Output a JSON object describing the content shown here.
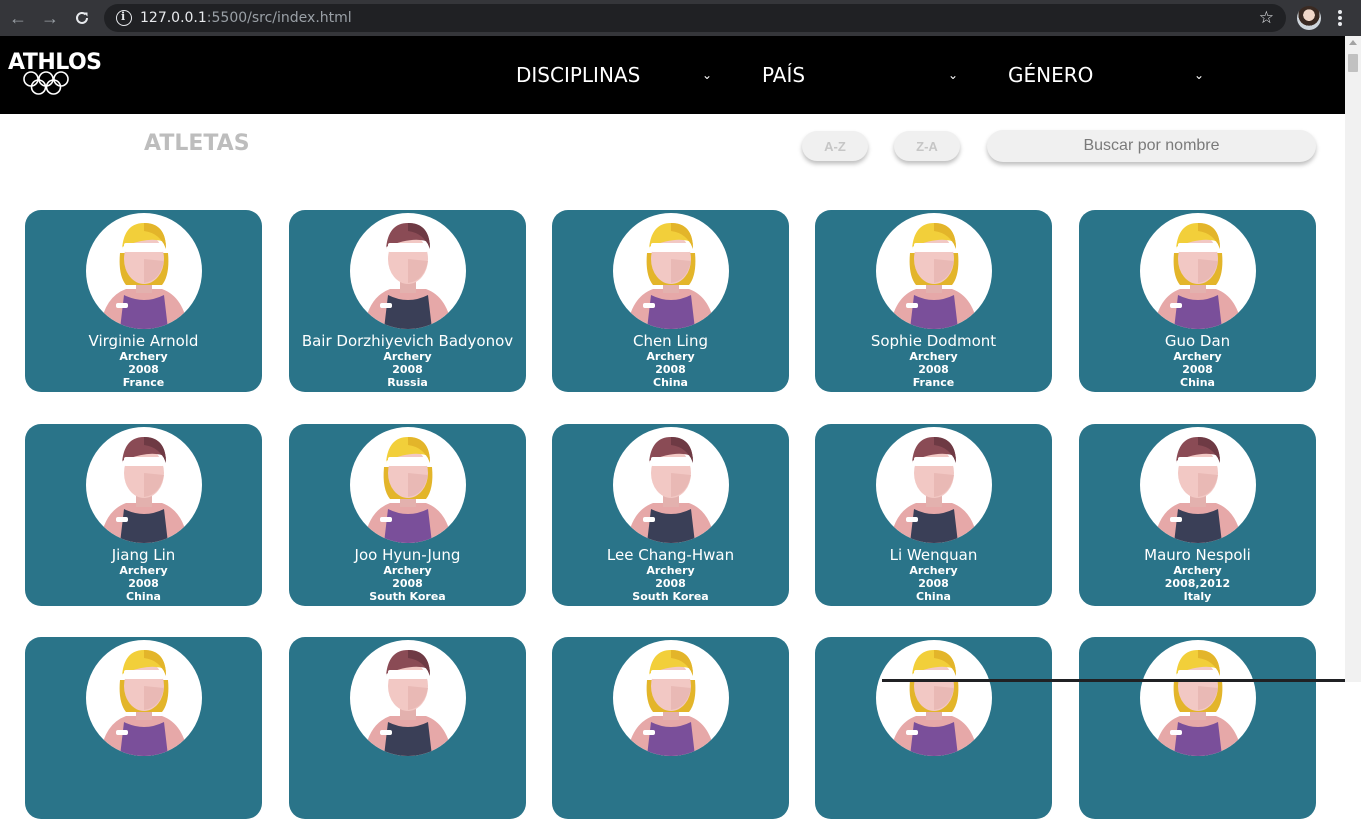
{
  "browser": {
    "url_host": "127.0.0.1",
    "url_rest": ":5500/src/index.html"
  },
  "header": {
    "logo_text": "ATHLOS",
    "filters": [
      {
        "label": "DISCIPLINAS"
      },
      {
        "label": "PAÍS"
      },
      {
        "label": "GÉNERO"
      }
    ]
  },
  "toolbar": {
    "title": "ATLETAS",
    "sort_az": "A-Z",
    "sort_za": "Z-A",
    "search_placeholder": "Buscar por nombre"
  },
  "colors": {
    "card": "#2a7489",
    "header": "#000000",
    "blonde_hair": "#f2cf3a",
    "brown_hair": "#8a4b55"
  },
  "athletes": [
    {
      "name": "Virginie Arnold",
      "sport": "Archery",
      "years": "2008",
      "country": "France",
      "avatar": "female-athlete-icon"
    },
    {
      "name": "Bair Dorzhiyevich Badyonov",
      "sport": "Archery",
      "years": "2008",
      "country": "Russia",
      "avatar": "male-athlete-icon"
    },
    {
      "name": "Chen Ling",
      "sport": "Archery",
      "years": "2008",
      "country": "China",
      "avatar": "female-athlete-icon"
    },
    {
      "name": "Sophie Dodmont",
      "sport": "Archery",
      "years": "2008",
      "country": "France",
      "avatar": "female-athlete-icon"
    },
    {
      "name": "Guo Dan",
      "sport": "Archery",
      "years": "2008",
      "country": "China",
      "avatar": "female-athlete-icon"
    },
    {
      "name": "Jiang Lin",
      "sport": "Archery",
      "years": "2008",
      "country": "China",
      "avatar": "male-athlete-icon"
    },
    {
      "name": "Joo Hyun-Jung",
      "sport": "Archery",
      "years": "2008",
      "country": "South Korea",
      "avatar": "female-athlete-icon"
    },
    {
      "name": "Lee Chang-Hwan",
      "sport": "Archery",
      "years": "2008",
      "country": "South Korea",
      "avatar": "male-athlete-icon"
    },
    {
      "name": "Li Wenquan",
      "sport": "Archery",
      "years": "2008",
      "country": "China",
      "avatar": "male-athlete-icon"
    },
    {
      "name": "Mauro Nespoli",
      "sport": "Archery",
      "years": "2008,2012",
      "country": "Italy",
      "avatar": "male-athlete-icon"
    },
    {
      "name": "",
      "sport": "",
      "years": "",
      "country": "",
      "avatar": "female-athlete-icon"
    },
    {
      "name": "",
      "sport": "",
      "years": "",
      "country": "",
      "avatar": "male-athlete-icon"
    },
    {
      "name": "",
      "sport": "",
      "years": "",
      "country": "",
      "avatar": "female-athlete-icon"
    },
    {
      "name": "",
      "sport": "",
      "years": "",
      "country": "",
      "avatar": "female-athlete-icon"
    },
    {
      "name": "",
      "sport": "",
      "years": "",
      "country": "",
      "avatar": "female-athlete-icon"
    }
  ]
}
